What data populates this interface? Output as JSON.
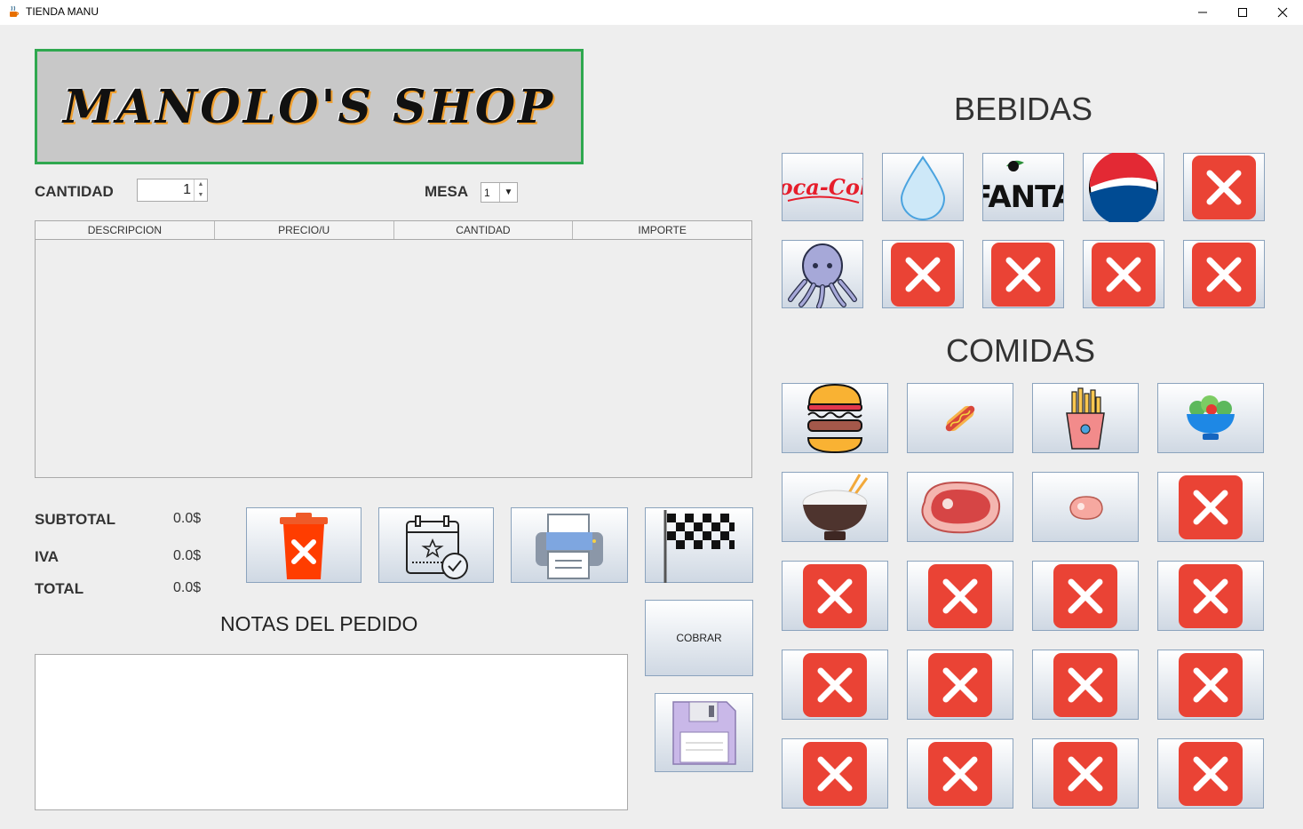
{
  "window": {
    "title": "TIENDA MANU"
  },
  "logo": {
    "text": "MANOLO'S SHOP"
  },
  "form": {
    "cantidad_label": "CANTIDAD",
    "cantidad_value": "1",
    "mesa_label": "MESA",
    "mesa_value": "1"
  },
  "table": {
    "columns": [
      "DESCRIPCION",
      "PRECIO/U",
      "CANTIDAD",
      "IMPORTE"
    ],
    "rows": []
  },
  "totals": {
    "subtotal_label": "SUBTOTAL",
    "subtotal_value": "0.0$",
    "iva_label": "IVA",
    "iva_value": "0.0$",
    "total_label": "TOTAL",
    "total_value": "0.0$"
  },
  "actions": {
    "delete_icon": "trash-x-icon",
    "calendar_icon": "calendar-check-icon",
    "print_icon": "printer-icon",
    "finish_icon": "checkered-flag-icon",
    "cobrar_label": "COBRAR",
    "save_icon": "floppy-disk-icon"
  },
  "notes": {
    "title": "NOTAS DEL PEDIDO",
    "value": ""
  },
  "bebidas": {
    "title": "BEBIDAS",
    "items": [
      {
        "icon": "coca-cola-icon",
        "logo_text": "Coca-Cola"
      },
      {
        "icon": "water-drop-icon"
      },
      {
        "icon": "fanta-icon",
        "logo_text": "FANTA"
      },
      {
        "icon": "pepsi-icon"
      },
      {
        "icon": "empty-slot-x-icon"
      },
      {
        "icon": "octopus-icon"
      },
      {
        "icon": "empty-slot-x-icon"
      },
      {
        "icon": "empty-slot-x-icon"
      },
      {
        "icon": "empty-slot-x-icon"
      },
      {
        "icon": "empty-slot-x-icon"
      }
    ]
  },
  "comidas": {
    "title": "COMIDAS",
    "items": [
      {
        "icon": "burger-icon"
      },
      {
        "icon": "hotdog-icon"
      },
      {
        "icon": "fries-icon"
      },
      {
        "icon": "salad-icon"
      },
      {
        "icon": "rice-bowl-icon"
      },
      {
        "icon": "steak-icon"
      },
      {
        "icon": "small-meat-icon"
      },
      {
        "icon": "empty-slot-x-icon"
      },
      {
        "icon": "empty-slot-x-icon"
      },
      {
        "icon": "empty-slot-x-icon"
      },
      {
        "icon": "empty-slot-x-icon"
      },
      {
        "icon": "empty-slot-x-icon"
      },
      {
        "icon": "empty-slot-x-icon"
      },
      {
        "icon": "empty-slot-x-icon"
      },
      {
        "icon": "empty-slot-x-icon"
      },
      {
        "icon": "empty-slot-x-icon"
      },
      {
        "icon": "empty-slot-x-icon"
      },
      {
        "icon": "empty-slot-x-icon"
      },
      {
        "icon": "empty-slot-x-icon"
      },
      {
        "icon": "empty-slot-x-icon"
      }
    ]
  },
  "colors": {
    "logo_border": "#2fa84f",
    "x_red": "#ea4335",
    "button_border": "#8ba3bd"
  }
}
